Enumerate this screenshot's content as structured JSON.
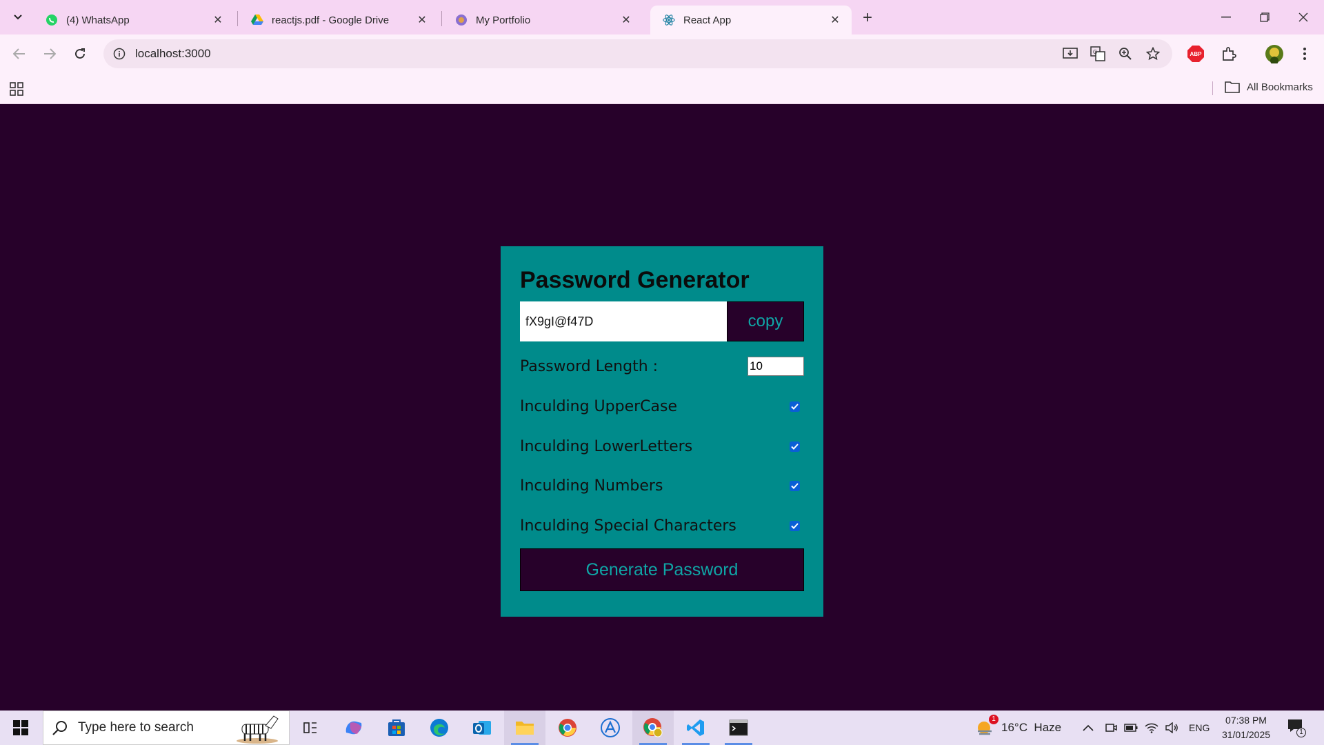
{
  "browser": {
    "tabs": [
      {
        "title": "(4) WhatsApp",
        "icon": "whatsapp-icon"
      },
      {
        "title": "reactjs.pdf - Google Drive",
        "icon": "google-drive-icon"
      },
      {
        "title": "My Portfolio",
        "icon": "portfolio-icon"
      },
      {
        "title": "React App",
        "icon": "react-icon",
        "active": true
      }
    ],
    "url": "localhost:3000",
    "bookmarks_all": "All Bookmarks",
    "extension_badge": "ABP"
  },
  "app": {
    "title": "Password Generator",
    "password_value": "fX9gI@f47D",
    "copy_label": "copy",
    "length_label": "Password Length :",
    "length_value": "10",
    "options": [
      {
        "label": "Inculding UpperCase",
        "checked": true
      },
      {
        "label": "Inculding LowerLetters",
        "checked": true
      },
      {
        "label": "Inculding Numbers",
        "checked": true
      },
      {
        "label": "Inculding Special Characters",
        "checked": true
      }
    ],
    "generate_label": "Generate Password"
  },
  "taskbar": {
    "search_placeholder": "Type here to search",
    "weather": "16°C  Haze",
    "weather_badge": "1",
    "language": "ENG",
    "time": "07:38 PM",
    "date": "31/01/2025",
    "notification_count": "1"
  },
  "colors": {
    "page_bg": "#27012a",
    "card_bg": "#008b8b",
    "button_bg": "#27012a",
    "button_text": "#0fa6a6",
    "checkbox": "#0a5fd6"
  }
}
